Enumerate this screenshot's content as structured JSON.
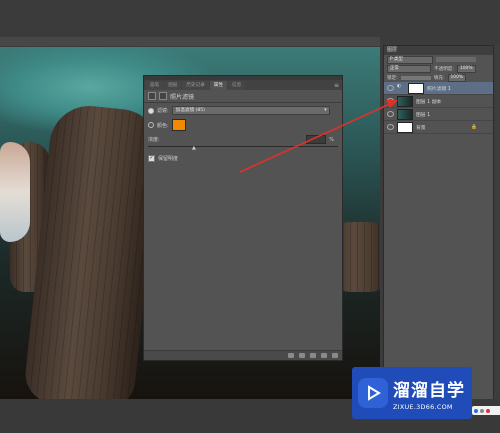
{
  "properties": {
    "tabs": [
      {
        "label": "画笔"
      },
      {
        "label": "图层"
      },
      {
        "label": "历史记录"
      },
      {
        "label": "属性"
      },
      {
        "label": "信息"
      }
    ],
    "header_label": "照片滤镜",
    "filter_label": "滤镜:",
    "filter_value": "加温滤镜 (85)",
    "color_label": "颜色:",
    "color_hex": "#f28a00",
    "density_label": "浓度:",
    "density_unit": "%",
    "preserve_label": "保留明度"
  },
  "layers": {
    "panel_title": "图层",
    "kind_label": "P 类型",
    "blend_mode": "正常",
    "opacity_label": "不透明度:",
    "opacity_value": "100%",
    "lock_label": "锁定:",
    "fill_label": "填充:",
    "fill_value": "100%",
    "items": [
      {
        "name": "照片滤镜 1",
        "selected": true
      },
      {
        "name": "图层 1 副本",
        "selected": false
      },
      {
        "name": "图层 1",
        "selected": false
      },
      {
        "name": "背景",
        "selected": false
      }
    ]
  },
  "watermark": {
    "title": "溜溜自学",
    "url": "ZIXUE.3D66.COM"
  },
  "colors": {
    "accent_arrow": "#e0302a",
    "selection": "#5c6f87",
    "brand_blue": "#1f4cb8"
  }
}
